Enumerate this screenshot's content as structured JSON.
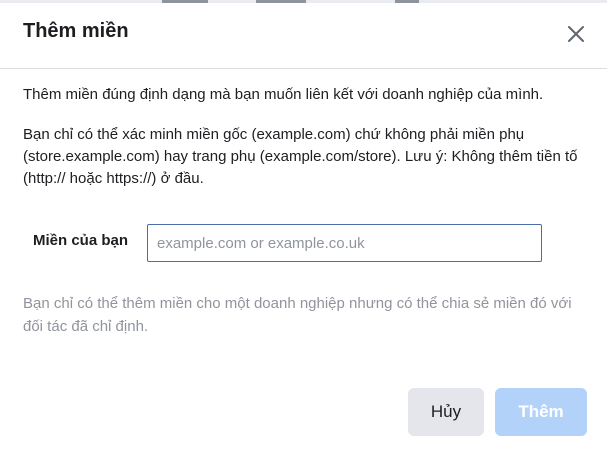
{
  "dialog": {
    "title": "Thêm miền",
    "close_icon": "close-icon",
    "intro": "Thêm miền đúng định dạng mà bạn muốn liên kết với doanh nghiệp của mình.",
    "details": "Bạn chỉ có thể xác minh miền gốc (example.com) chứ không phải miền phụ (store.example.com) hay trang phụ (example.com/store). Lưu ý: Không thêm tiền tố (http:// hoặc https://) ở đầu.",
    "domain_field": {
      "label": "Miền của bạn",
      "value": "",
      "placeholder": "example.com or example.co.uk"
    },
    "help": "Bạn chỉ có thể thêm miền cho một doanh nghiệp nhưng có thể chia sẻ miền đó với đối tác đã chỉ định.",
    "buttons": {
      "cancel": "Hủy",
      "add": "Thêm"
    }
  },
  "colors": {
    "accent_disabled": "#b3d2fa",
    "input_border": "#4a6ea9",
    "secondary_text": "#90949c",
    "cancel_bg": "#e4e6eb"
  }
}
